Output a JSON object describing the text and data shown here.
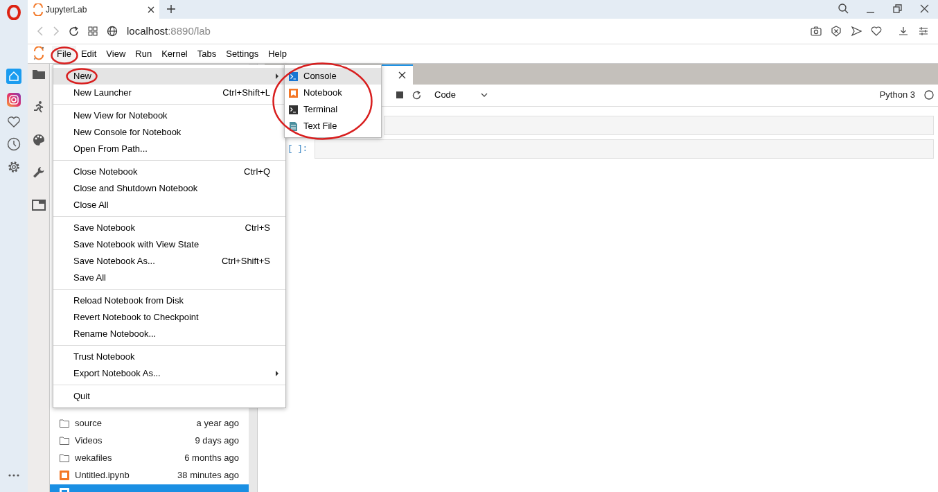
{
  "browser": {
    "tabs": [
      {
        "title": "JupyterLab",
        "selected": true
      }
    ],
    "address": {
      "host": "localhost",
      "rest": ":8890/lab"
    }
  },
  "menubar": [
    {
      "label": "File",
      "selected": true
    },
    {
      "label": "Edit",
      "selected": false
    },
    {
      "label": "View",
      "selected": false
    },
    {
      "label": "Run",
      "selected": false
    },
    {
      "label": "Kernel",
      "selected": false
    },
    {
      "label": "Tabs",
      "selected": false
    },
    {
      "label": "Settings",
      "selected": false
    },
    {
      "label": "Help",
      "selected": false
    }
  ],
  "file_menu": [
    [
      {
        "label": "New",
        "submenu": true,
        "highlighted": true
      },
      {
        "label": "New Launcher",
        "shortcut": "Ctrl+Shift+L",
        "submenu": false,
        "highlighted": false
      }
    ],
    [
      {
        "label": "New View for Notebook",
        "submenu": false,
        "highlighted": false
      },
      {
        "label": "New Console for Notebook",
        "submenu": false,
        "highlighted": false
      },
      {
        "label": "Open From Path...",
        "submenu": false,
        "highlighted": false
      }
    ],
    [
      {
        "label": "Close Notebook",
        "shortcut": "Ctrl+Q",
        "submenu": false,
        "highlighted": false
      },
      {
        "label": "Close and Shutdown Notebook",
        "submenu": false,
        "highlighted": false
      },
      {
        "label": "Close All",
        "submenu": false,
        "highlighted": false
      }
    ],
    [
      {
        "label": "Save Notebook",
        "shortcut": "Ctrl+S",
        "submenu": false,
        "highlighted": false
      },
      {
        "label": "Save Notebook with View State",
        "submenu": false,
        "highlighted": false
      },
      {
        "label": "Save Notebook As...",
        "shortcut": "Ctrl+Shift+S",
        "submenu": false,
        "highlighted": false
      },
      {
        "label": "Save All",
        "submenu": false,
        "highlighted": false
      }
    ],
    [
      {
        "label": "Reload Notebook from Disk",
        "submenu": false,
        "highlighted": false
      },
      {
        "label": "Revert Notebook to Checkpoint",
        "submenu": false,
        "highlighted": false
      },
      {
        "label": "Rename Notebook...",
        "submenu": false,
        "highlighted": false
      }
    ],
    [
      {
        "label": "Trust Notebook",
        "submenu": false,
        "highlighted": false
      },
      {
        "label": "Export Notebook As...",
        "submenu": true,
        "highlighted": false
      }
    ],
    [
      {
        "label": "Quit",
        "submenu": false,
        "highlighted": false
      }
    ]
  ],
  "new_submenu": [
    {
      "label": "Console",
      "kind": "console",
      "highlighted": true
    },
    {
      "label": "Notebook",
      "kind": "notebook",
      "highlighted": false
    },
    {
      "label": "Terminal",
      "kind": "terminal",
      "highlighted": false
    },
    {
      "label": "Text File",
      "kind": "textfile",
      "highlighted": false
    }
  ],
  "notebook_toolbar": {
    "cell_type": "Code",
    "kernel": "Python 3"
  },
  "cells": [
    {},
    {
      "prompt": "[ ]:"
    }
  ],
  "files": [
    {
      "name": "source",
      "kind": "folder",
      "modified": "a year ago",
      "selected": false
    },
    {
      "name": "Videos",
      "kind": "folder",
      "modified": "9 days ago",
      "selected": false
    },
    {
      "name": "wekafiles",
      "kind": "folder",
      "modified": "6 months ago",
      "selected": false
    },
    {
      "name": "Untitled.ipynb",
      "kind": "notebook",
      "modified": "38 minutes ago",
      "selected": false
    },
    {
      "kind": "notebook",
      "selected": true
    }
  ]
}
